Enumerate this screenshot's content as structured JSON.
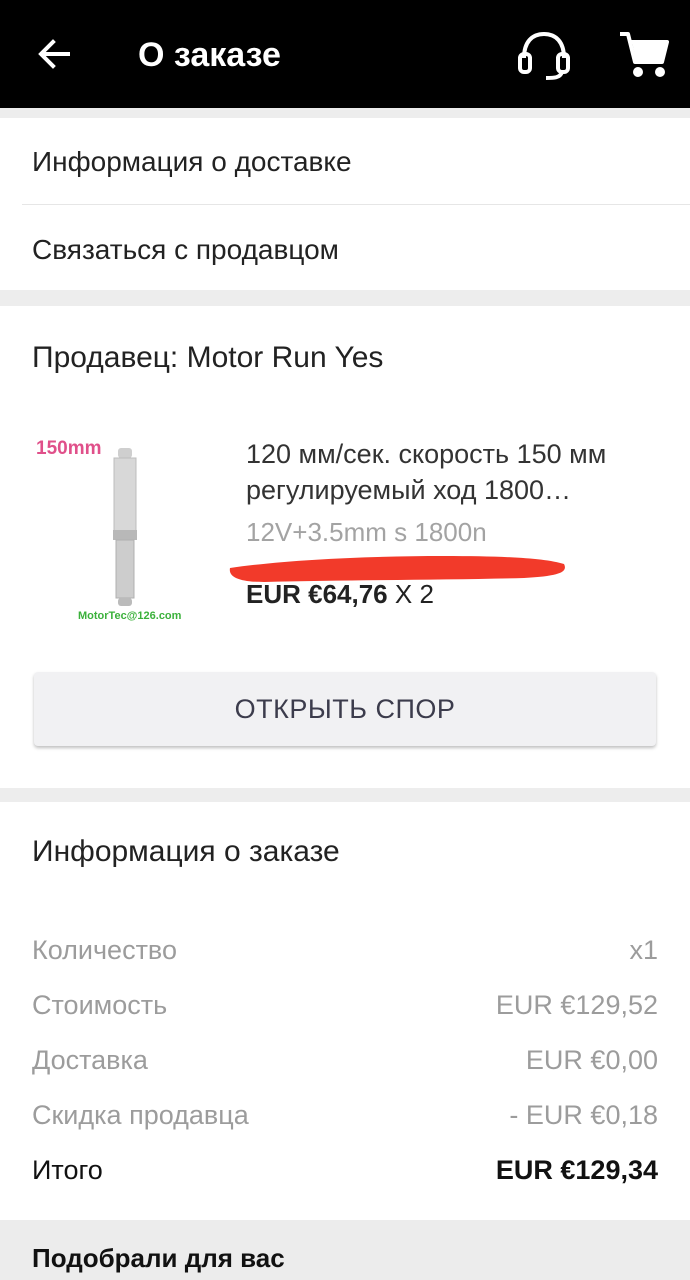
{
  "header": {
    "title": "О заказе",
    "back_icon": "arrow-left-icon",
    "support_icon": "headset-icon",
    "cart_icon": "cart-icon"
  },
  "links": {
    "delivery_info": "Информация о доставке",
    "contact_seller": "Связаться с продавцом"
  },
  "seller": {
    "label": "Продавец: Motor Run Yes"
  },
  "product": {
    "image_label": "150mm",
    "image_email": "MotorTec@126.com",
    "name": "120 мм/сек. скорость 150 мм регулируемый ход 1800…",
    "variant": "12V+3.5mm s 1800n",
    "price": "EUR €64,76",
    "qty": " X 2"
  },
  "dispute_button": "ОТКРЫТЬ СПОР",
  "order_info": {
    "title": "Информация о заказе",
    "rows": [
      {
        "label": "Количество",
        "value": "x1"
      },
      {
        "label": "Стоимость",
        "value": "EUR €129,52"
      },
      {
        "label": "Доставка",
        "value": "EUR €0,00"
      },
      {
        "label": "Скидка продавца",
        "value": "- EUR €0,18"
      }
    ],
    "total": {
      "label": "Итого",
      "value": "EUR €129,34"
    }
  },
  "recommendations": {
    "title": "Подобрали для вас"
  },
  "colors": {
    "appbar": "#000000",
    "redaction": "#f23a2a",
    "size_label": "#e0508a",
    "email_label": "#3bb13b"
  }
}
